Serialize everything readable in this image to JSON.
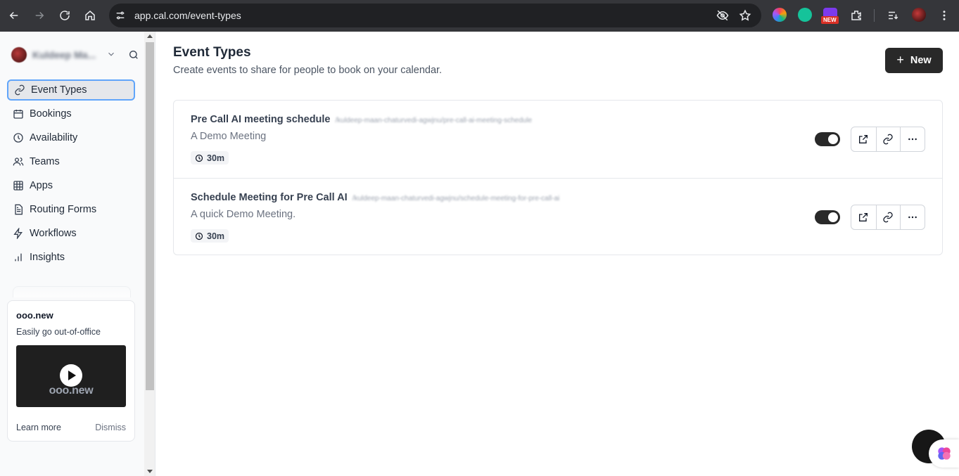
{
  "browser": {
    "url": "app.cal.com/event-types",
    "extension_badge": "NEW"
  },
  "sidebar": {
    "user_name": "Kuldeep Ma...",
    "items": [
      {
        "label": "Event Types",
        "icon": "link-icon",
        "active": true
      },
      {
        "label": "Bookings",
        "icon": "calendar-icon"
      },
      {
        "label": "Availability",
        "icon": "clock-icon"
      },
      {
        "label": "Teams",
        "icon": "users-icon"
      },
      {
        "label": "Apps",
        "icon": "grid-icon"
      },
      {
        "label": "Routing Forms",
        "icon": "file-text-icon"
      },
      {
        "label": "Workflows",
        "icon": "zap-icon"
      },
      {
        "label": "Insights",
        "icon": "bar-chart-icon"
      }
    ],
    "promo": {
      "title": "ooo.new",
      "description": "Easily go out-of-office",
      "video_text": "ooo.new",
      "learn_more": "Learn more",
      "dismiss": "Dismiss"
    }
  },
  "main": {
    "title": "Event Types",
    "subtitle": "Create events to share for people to book on your calendar.",
    "new_button": "New",
    "events": [
      {
        "title": "Pre Call AI meeting schedule",
        "slug": "/kuldeep-maan-chaturvedi-agwjnu/pre-call-ai-meeting-schedule",
        "description": "A Demo Meeting",
        "duration": "30m",
        "enabled": true
      },
      {
        "title": "Schedule Meeting for Pre Call AI",
        "slug": "/kuldeep-maan-chaturvedi-agwjnu/schedule-meeting-for-pre-call-ai",
        "description": "A quick Demo Meeting.",
        "duration": "30m",
        "enabled": true
      }
    ]
  },
  "colors": {
    "primary_button": "#292929",
    "active_nav_border": "#60a5fa",
    "chrome_bg": "#35363a"
  }
}
